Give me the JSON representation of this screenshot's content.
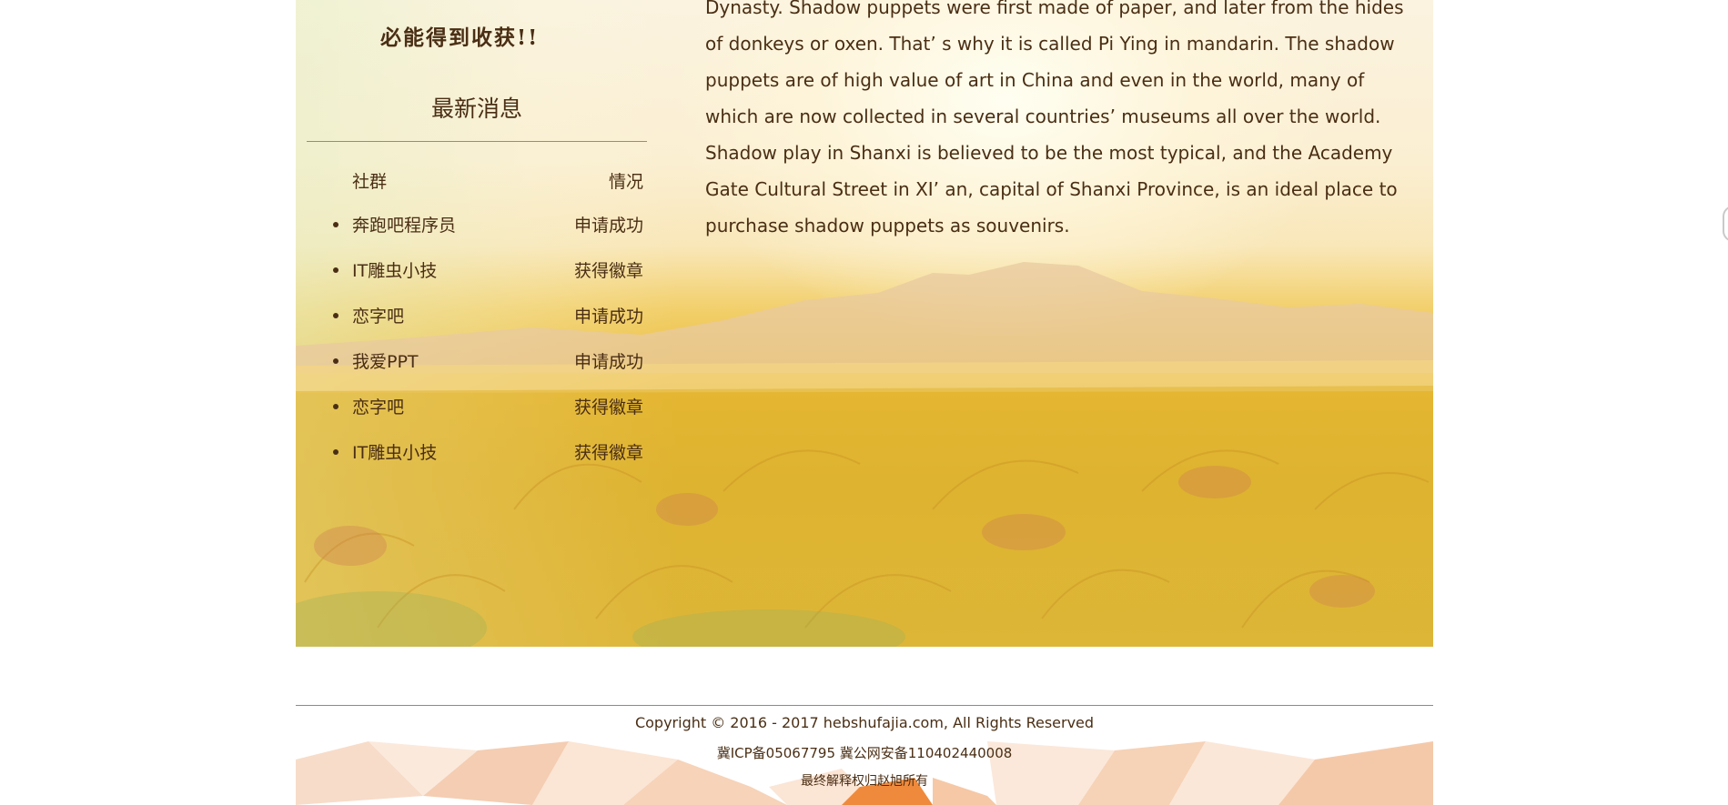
{
  "sidebar": {
    "slogan": "必能得到收获!!",
    "heading": "最新消息",
    "columns": {
      "community": "社群",
      "status": "情况"
    },
    "items": [
      {
        "name": "奔跑吧程序员",
        "status": "申请成功"
      },
      {
        "name": "IT雕虫小技",
        "status": "获得徽章"
      },
      {
        "name": "恋字吧",
        "status": "申请成功"
      },
      {
        "name": "我爱PPT",
        "status": "申请成功"
      },
      {
        "name": "恋字吧",
        "status": "获得徽章"
      },
      {
        "name": "IT雕虫小技",
        "status": "获得徽章"
      }
    ]
  },
  "article": {
    "text": "Dynasty. Shadow puppets were first made of paper, and later from the hides of donkeys or oxen. That’ s why it is called Pi Ying in mandarin. The shadow puppets are of high value of art in China and even in the world, many of which are now collected in several countries’  museums all over the world. Shadow play in Shanxi is believed to be the most typical, and the Academy Gate Cultural Street in XI’ an, capital of Shanxi Province, is an ideal place to purchase shadow puppets as souvenirs."
  },
  "footer": {
    "copyright": "Copyright © 2016 - 2017 hebshufajia.com, All Rights Reserved",
    "icp": "冀ICP备05067795 冀公网安备110402440008",
    "rights": "最终解释权归赵旭所有"
  },
  "colors": {
    "text": "#4a2e14",
    "field": "#e7b830",
    "sky": "#fbf3e0"
  }
}
